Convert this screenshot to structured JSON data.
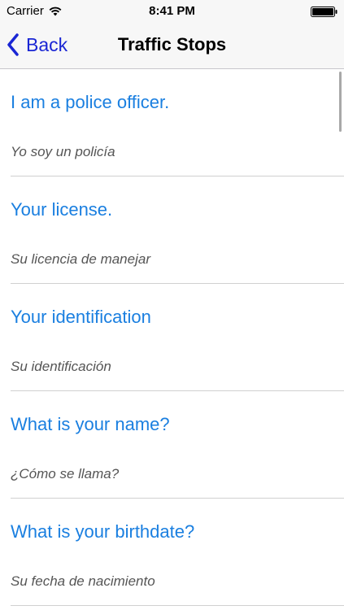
{
  "status_bar": {
    "carrier": "Carrier",
    "time": "8:41 PM",
    "wifi_icon": "wifi-icon",
    "battery_icon": "battery-icon"
  },
  "nav": {
    "back_label": "Back",
    "back_icon": "chevron-left-icon",
    "title": "Traffic Stops",
    "accent_color": "#1a26d4"
  },
  "phrases": [
    {
      "english": "I am a police officer.",
      "spanish": "Yo soy un policía"
    },
    {
      "english": "Your license.",
      "spanish": "Su licencia de manejar"
    },
    {
      "english": "Your identification",
      "spanish": "Su identificación"
    },
    {
      "english": "What is your name?",
      "spanish": "¿Cómo se llama?"
    },
    {
      "english": "What is your birthdate?",
      "spanish": "Su fecha de nacimiento"
    }
  ],
  "colors": {
    "english_text": "#1a7fe0",
    "spanish_text": "#555555"
  }
}
